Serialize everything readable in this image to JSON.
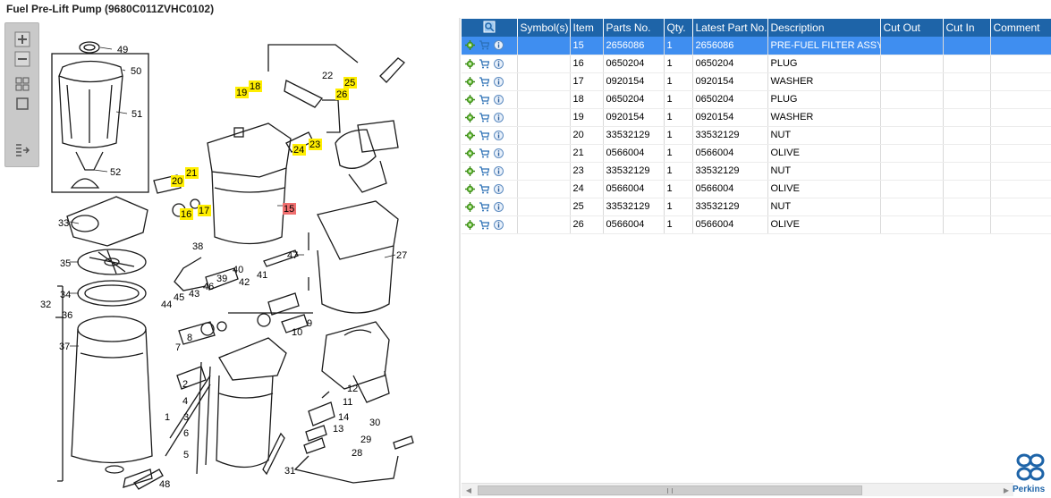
{
  "window": {
    "title": "Fuel Pre-Lift Pump (9680C011ZVHC0102)"
  },
  "tools": {
    "zoom_in": "zoom-in-icon",
    "zoom_out": "zoom-out-icon",
    "fit_all": "fit-all-icon",
    "fit_page": "fit-page-icon",
    "export": "export-icon"
  },
  "diagram": {
    "callouts": [
      "49",
      "50",
      "51",
      "52",
      "33",
      "35",
      "34",
      "32",
      "36",
      "37",
      "22",
      "25",
      "26",
      "18",
      "19",
      "23",
      "24",
      "21",
      "20",
      "16",
      "17",
      "15",
      "27",
      "38",
      "47",
      "39",
      "40",
      "41",
      "42",
      "46",
      "43",
      "45",
      "44",
      "9",
      "10",
      "8",
      "7",
      "2",
      "4",
      "3",
      "1",
      "6",
      "5",
      "12",
      "11",
      "14",
      "13",
      "30",
      "29",
      "28",
      "31",
      "48"
    ],
    "highlighted": [
      "18",
      "19",
      "25",
      "26",
      "23",
      "24",
      "21",
      "20",
      "16",
      "17"
    ],
    "selected": "15",
    "highlight_color": "#ffee00",
    "selected_color": "#f06f6f"
  },
  "table": {
    "columns": [
      "Symbol(s)",
      "Item",
      "Parts No.",
      "Qty.",
      "Latest Part No.",
      "Description",
      "Cut Out",
      "Cut In",
      "Comment"
    ],
    "header_icon": "locate-in-diagram-icon",
    "row_icons": [
      "gear-icon",
      "cart-icon",
      "info-icon"
    ],
    "rows": [
      {
        "item": "15",
        "part": "2656086",
        "qty": "1",
        "latest": "2656086",
        "desc": "PRE-FUEL FILTER ASSY",
        "cut_out": "",
        "cut_in": "",
        "comment": ""
      },
      {
        "item": "16",
        "part": "0650204",
        "qty": "1",
        "latest": "0650204",
        "desc": "PLUG",
        "cut_out": "",
        "cut_in": "",
        "comment": ""
      },
      {
        "item": "17",
        "part": "0920154",
        "qty": "1",
        "latest": "0920154",
        "desc": "WASHER",
        "cut_out": "",
        "cut_in": "",
        "comment": ""
      },
      {
        "item": "18",
        "part": "0650204",
        "qty": "1",
        "latest": "0650204",
        "desc": "PLUG",
        "cut_out": "",
        "cut_in": "",
        "comment": ""
      },
      {
        "item": "19",
        "part": "0920154",
        "qty": "1",
        "latest": "0920154",
        "desc": "WASHER",
        "cut_out": "",
        "cut_in": "",
        "comment": ""
      },
      {
        "item": "20",
        "part": "33532129",
        "qty": "1",
        "latest": "33532129",
        "desc": "NUT",
        "cut_out": "",
        "cut_in": "",
        "comment": ""
      },
      {
        "item": "21",
        "part": "0566004",
        "qty": "1",
        "latest": "0566004",
        "desc": "OLIVE",
        "cut_out": "",
        "cut_in": "",
        "comment": ""
      },
      {
        "item": "23",
        "part": "33532129",
        "qty": "1",
        "latest": "33532129",
        "desc": "NUT",
        "cut_out": "",
        "cut_in": "",
        "comment": ""
      },
      {
        "item": "24",
        "part": "0566004",
        "qty": "1",
        "latest": "0566004",
        "desc": "OLIVE",
        "cut_out": "",
        "cut_in": "",
        "comment": ""
      },
      {
        "item": "25",
        "part": "33532129",
        "qty": "1",
        "latest": "33532129",
        "desc": "NUT",
        "cut_out": "",
        "cut_in": "",
        "comment": ""
      },
      {
        "item": "26",
        "part": "0566004",
        "qty": "1",
        "latest": "0566004",
        "desc": "OLIVE",
        "cut_out": "",
        "cut_in": "",
        "comment": ""
      }
    ],
    "selected_row": "15"
  },
  "brand": {
    "name": "Perkins",
    "color": "#1e64a8"
  }
}
